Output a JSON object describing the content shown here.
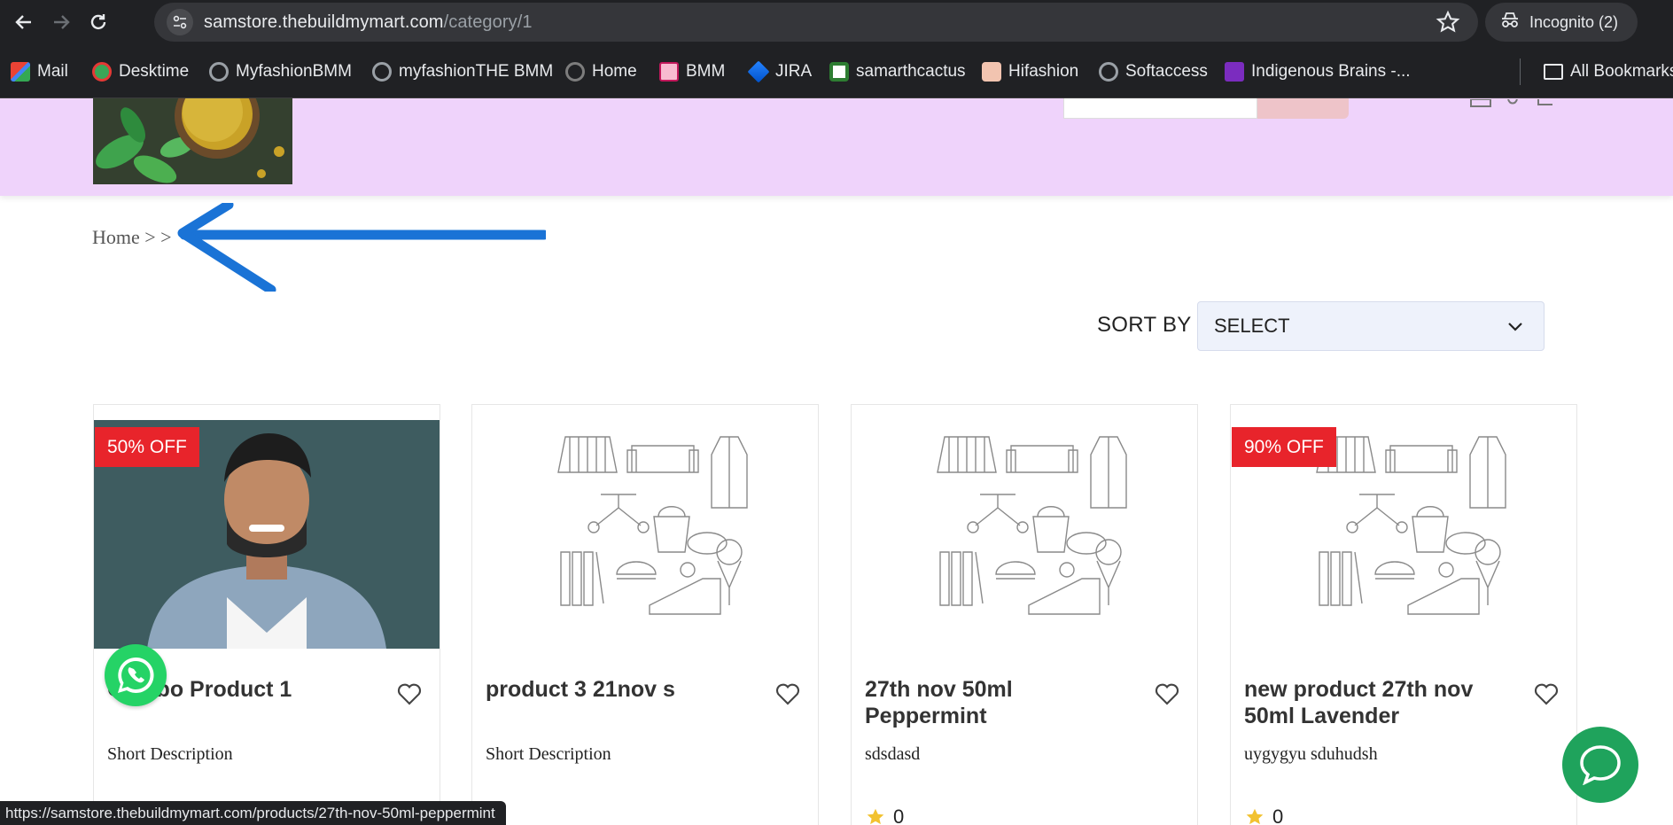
{
  "browser": {
    "url_host": "samstore.thebuildmymart.com",
    "url_path": "/category/1",
    "incognito_label": "Incognito (2)",
    "bookmarks": [
      {
        "label": "Mail",
        "icon": "gmail-icon",
        "color": "#ea4335"
      },
      {
        "label": "Desktime",
        "icon": "desktime-icon",
        "color": "#3aa657"
      },
      {
        "label": "MyfashionBMM",
        "icon": "globe-icon",
        "color": "#9aa0a6"
      },
      {
        "label": "myfashionTHE BMM",
        "icon": "globe-icon",
        "color": "#9aa0a6"
      },
      {
        "label": "Home",
        "icon": "globe-icon",
        "color": "#7d7d7d"
      },
      {
        "label": "BMM",
        "icon": "bmm-icon",
        "color": "#c2185b"
      },
      {
        "label": "JIRA",
        "icon": "jira-icon",
        "color": "#2684ff"
      },
      {
        "label": "samarthcactus",
        "icon": "cactus-icon",
        "color": "#2e7d32"
      },
      {
        "label": "Hifashion",
        "icon": "hifashion-icon",
        "color": "#f2c4b0"
      },
      {
        "label": "Softaccess",
        "icon": "globe-icon",
        "color": "#9aa0a6"
      },
      {
        "label": "Indigenous Brains -...",
        "icon": "indigenous-icon",
        "color": "#7b2cbf"
      }
    ],
    "all_bookmarks_label": "All Bookmarks",
    "status_url": "https://samstore.thebuildmymart.com/products/27th-nov-50ml-peppermint"
  },
  "breadcrumb": "Home > >",
  "sort": {
    "label": "SORT BY",
    "selected": "SELECT"
  },
  "products": [
    {
      "badge": "50% OFF",
      "title": "Combo Product 1",
      "desc": "Short Description",
      "rating": "",
      "image": "person-photo"
    },
    {
      "badge": "",
      "title": "product 3 21nov s",
      "desc": "Short Description",
      "rating": "",
      "image": "placeholder-sketch"
    },
    {
      "badge": "",
      "title": "27th nov 50ml Peppermint",
      "desc": "sdsdasd",
      "rating": "0",
      "image": "placeholder-sketch"
    },
    {
      "badge": "90% OFF",
      "title": "new product 27th nov 50ml Lavender",
      "desc": "uygygyu sduhudsh",
      "rating": "0",
      "image": "placeholder-sketch"
    }
  ],
  "colors": {
    "header_bg": "#efd3fb",
    "badge": "#e8242b",
    "whatsapp": "#25d366",
    "chat": "#1fa35c",
    "annotation_arrow": "#1a73d6"
  }
}
